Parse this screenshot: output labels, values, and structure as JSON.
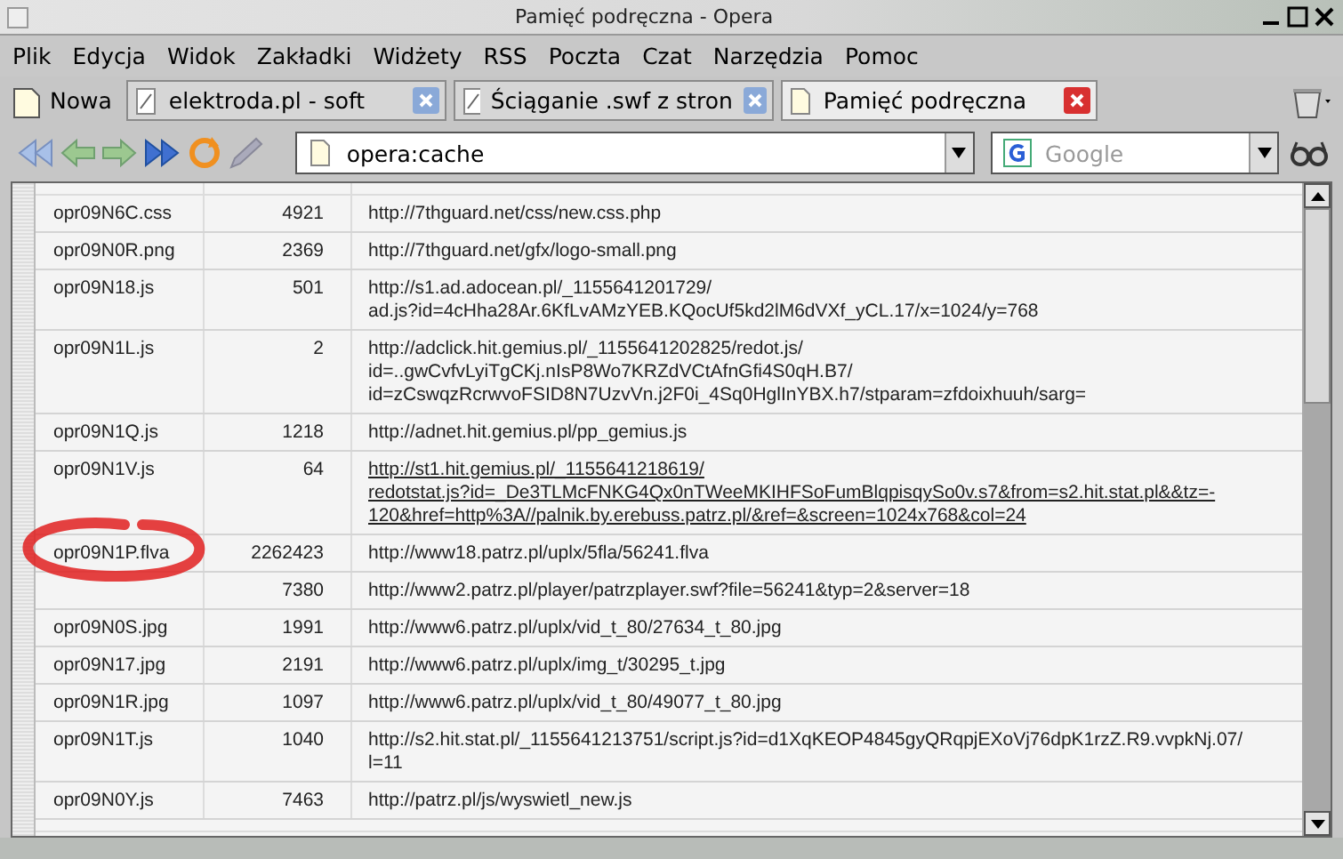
{
  "window": {
    "title": "Pamięć podręczna - Opera"
  },
  "menu": [
    "Plik",
    "Edycja",
    "Widok",
    "Zakładki",
    "Widżety",
    "RSS",
    "Poczta",
    "Czat",
    "Narzędzia",
    "Pomoc"
  ],
  "new_tab": {
    "label": "Nowa"
  },
  "tabs": [
    {
      "label": "elektroda.pl - soft",
      "selected": false
    },
    {
      "label": "Ściąganie .swf z stron",
      "selected": false
    },
    {
      "label": "Pamięć podręczna",
      "selected": true
    }
  ],
  "address": {
    "value": "opera:cache"
  },
  "search": {
    "placeholder": "Google"
  },
  "rows": [
    {
      "name": "opr09N6C.css",
      "size": "4921",
      "url": "http://7thguard.net/css/new.css.php",
      "underlined": false
    },
    {
      "name": "opr09N0R.png",
      "size": "2369",
      "url": "http://7thguard.net/gfx/logo-small.png",
      "underlined": false
    },
    {
      "name": "opr09N18.js",
      "size": "501",
      "url": "http://s1.ad.adocean.pl/_1155641201729/\nad.js?id=4cHha28Ar.6KfLvAMzYEB.KQocUf5kd2lM6dVXf_yCL.17/x=1024/y=768",
      "underlined": false
    },
    {
      "name": "opr09N1L.js",
      "size": "2",
      "url": "http://adclick.hit.gemius.pl/_1155641202825/redot.js/\nid=..gwCvfvLyiTgCKj.nIsP8Wo7KRZdVCtAfnGfi4S0qH.B7/\nid=zCswqzRcrwvoFSID8N7UzvVn.j2F0i_4Sq0HglInYBX.h7/stparam=zfdoixhuuh/sarg=",
      "underlined": false
    },
    {
      "name": "opr09N1Q.js",
      "size": "1218",
      "url": "http://adnet.hit.gemius.pl/pp_gemius.js",
      "underlined": false
    },
    {
      "name": "opr09N1V.js",
      "size": "64",
      "url": "http://st1.hit.gemius.pl/_1155641218619/\nredotstat.js?id=_De3TLMcFNKG4Qx0nTWeeMKIHFSoFumBlqpisqySo0v.s7&from=s2.hit.stat.pl&&tz=-\n120&href=http%3A//palnik.by.erebuss.patrz.pl/&ref=&screen=1024x768&col=24",
      "underlined": true
    },
    {
      "name": "opr09N1P.flva",
      "size": "2262423",
      "url": "http://www18.patrz.pl/uplx/5fla/56241.flva",
      "underlined": false
    },
    {
      "size": "7380",
      "url": "http://www2.patrz.pl/player/patrzplayer.swf?file=56241&typ=2&server=18",
      "underlined": false
    },
    {
      "name": "opr09N0S.jpg",
      "size": "1991",
      "url": "http://www6.patrz.pl/uplx/vid_t_80/27634_t_80.jpg",
      "underlined": false
    },
    {
      "name": "opr09N17.jpg",
      "size": "2191",
      "url": "http://www6.patrz.pl/uplx/img_t/30295_t.jpg",
      "underlined": false
    },
    {
      "name": "opr09N1R.jpg",
      "size": "1097",
      "url": "http://www6.patrz.pl/uplx/vid_t_80/49077_t_80.jpg",
      "underlined": false
    },
    {
      "name": "opr09N1T.js",
      "size": "1040",
      "url": "http://s2.hit.stat.pl/_1155641213751/script.js?id=d1XqKEOP4845gyQRqpjEXoVj76dpK1rzZ.R9.vvpkNj.07/\nl=11",
      "underlined": false
    },
    {
      "name": "opr09N0Y.js",
      "size": "7463",
      "url": "http://patrz.pl/js/wyswietl_new.js",
      "underlined": false
    }
  ]
}
